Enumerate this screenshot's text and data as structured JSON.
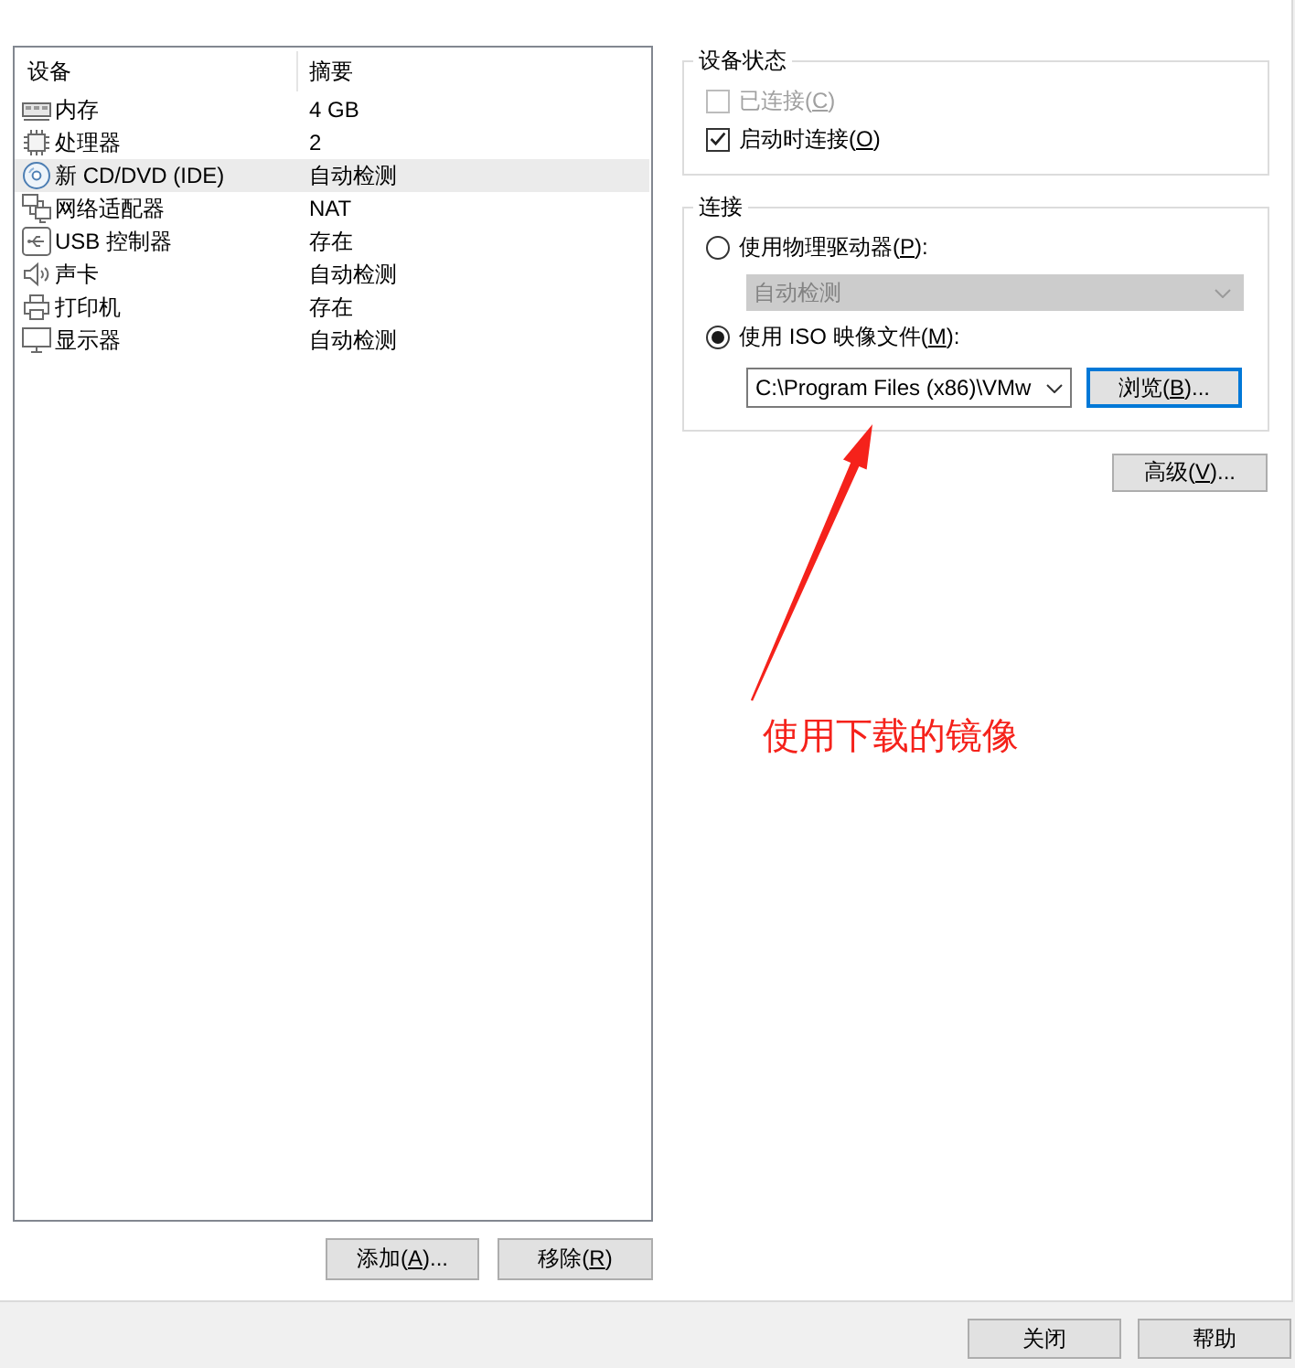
{
  "device_list": {
    "columns": [
      "设备",
      "摘要"
    ],
    "rows": [
      {
        "kind": "memory",
        "device": "内存",
        "summary": "4 GB",
        "selected": false
      },
      {
        "kind": "processor",
        "device": "处理器",
        "summary": "2",
        "selected": false
      },
      {
        "kind": "cd",
        "device": "新 CD/DVD (IDE)",
        "summary": "自动检测",
        "selected": true
      },
      {
        "kind": "network",
        "device": "网络适配器",
        "summary": "NAT",
        "selected": false
      },
      {
        "kind": "usb",
        "device": "USB 控制器",
        "summary": "存在",
        "selected": false
      },
      {
        "kind": "sound",
        "device": "声卡",
        "summary": "自动检测",
        "selected": false
      },
      {
        "kind": "printer",
        "device": "打印机",
        "summary": "存在",
        "selected": false
      },
      {
        "kind": "display",
        "device": "显示器",
        "summary": "自动检测",
        "selected": false
      }
    ]
  },
  "list_buttons": [
    {
      "before": "添加(",
      "access_key": "A",
      "after": ")..."
    },
    {
      "before": "移除(",
      "access_key": "R",
      "after": ")"
    }
  ],
  "device_status": {
    "title": "设备状态",
    "options": [
      {
        "before": "已连接(",
        "access_key": "C",
        "after": ")",
        "checked": false,
        "disabled": true
      },
      {
        "before": "启动时连接(",
        "access_key": "O",
        "after": ")",
        "checked": true,
        "disabled": false
      }
    ]
  },
  "connection": {
    "title": "连接",
    "options": [
      {
        "kind": "drive",
        "before": "使用物理驱动器(",
        "access_key": "P",
        "after": "):",
        "selected": false,
        "dropdown": {
          "value": "自动检测",
          "disabled": true
        }
      },
      {
        "kind": "iso",
        "before": "使用 ISO 映像文件(",
        "access_key": "M",
        "after": "):",
        "selected": true,
        "path": {
          "value": "C:\\Program Files (x86)\\VMw"
        },
        "browse_button": {
          "before": "浏览(",
          "access_key": "B",
          "after": ")...",
          "focused": true
        }
      }
    ]
  },
  "advanced_button": {
    "before": "高级(",
    "access_key": "V",
    "after": ")..."
  },
  "annotation": {
    "text": "使用下载的镜像"
  },
  "footer_buttons": [
    {
      "label": "关闭"
    },
    {
      "label": "帮助"
    }
  ]
}
